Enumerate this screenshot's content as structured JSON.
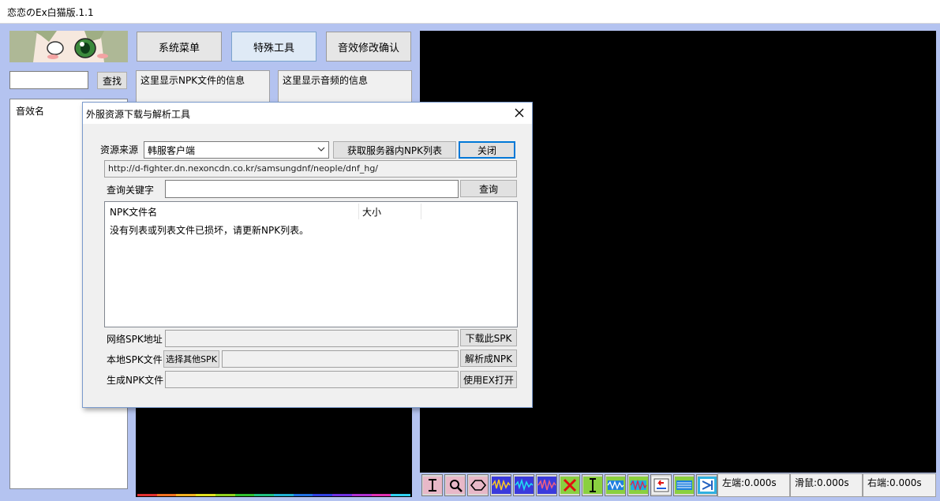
{
  "window": {
    "title": "恋恋のEx白猫版.1.1"
  },
  "toolbar": {
    "system_menu": "系统菜单",
    "special_tools": "特殊工具",
    "sound_confirm": "音效修改确认"
  },
  "search": {
    "value": "",
    "button": "查找"
  },
  "info": {
    "npk": "这里显示NPK文件的信息",
    "audio": "这里显示音频的信息"
  },
  "sound_list": {
    "header": "音效名"
  },
  "status": {
    "left": "左端:0.000s",
    "slider": "滑鼠:0.000s",
    "right": "右端:0.000s"
  },
  "wave_tools": [
    "select-range-icon",
    "zoom-icon",
    "zoom-fit-icon",
    "wave-icon-1",
    "wave-icon-2",
    "wave-icon-3",
    "delete-icon",
    "cursor-icon",
    "wave-icon-4",
    "wave-icon-5",
    "undo-icon",
    "amplify-icon",
    "export-icon"
  ],
  "dialog": {
    "title": "外服资源下载与解析工具",
    "source_label": "资源来源",
    "source_value": "韩服客户端",
    "fetch_button": "获取服务器内NPK列表",
    "close_button": "关闭",
    "url": "http://d-fighter.dn.nexoncdn.co.kr/samsungdnf/neople/dnf_hg/",
    "keyword_label": "查询关键字",
    "keyword_value": "",
    "query_button": "查询",
    "columns": {
      "name": "NPK文件名",
      "size": "大小"
    },
    "empty_message": "没有列表或列表文件已损坏，请更新NPK列表。",
    "net_spk_label": "网络SPK地址",
    "download_button": "下载此SPK",
    "local_spk_label": "本地SPK文件",
    "choose_button": "选择其他SPK",
    "parse_button": "解析成NPK",
    "gen_npk_label": "生成NPK文件",
    "open_ex_button": "使用EX打开"
  },
  "colors": {
    "background": "#b4c3f0",
    "accent": "#0078d7",
    "spectrum": [
      "#e03030",
      "#f07020",
      "#f0b020",
      "#e0e020",
      "#90d020",
      "#30c030",
      "#20c080",
      "#20b0d0",
      "#2070e0",
      "#3040e0",
      "#7030e0",
      "#b030d0",
      "#e030b0",
      "#30d0f0"
    ]
  }
}
